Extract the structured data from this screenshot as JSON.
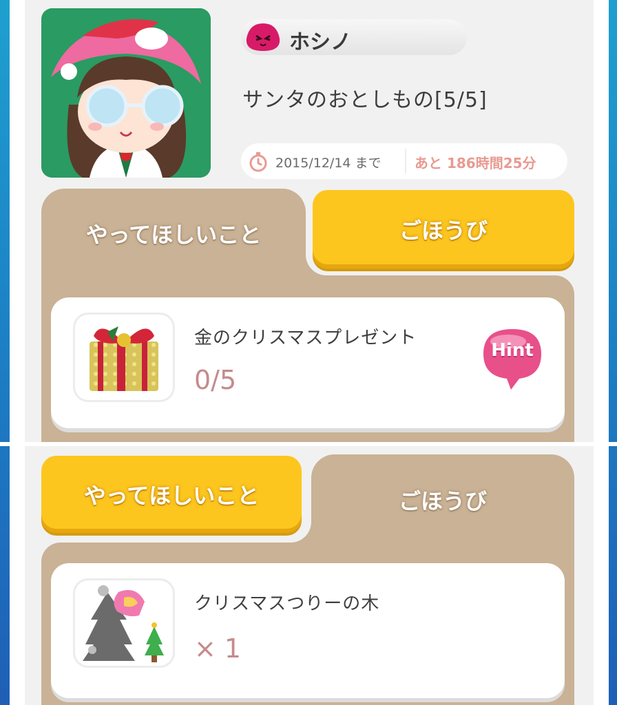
{
  "header": {
    "user_name": "ホシノ",
    "quest_title": "サンタのおとしもの[5/5]",
    "deadline": "2015/12/14 まで",
    "remaining": "あと 186時間25分"
  },
  "tabs": {
    "requests_label": "やってほしいこと",
    "rewards_label": "ごほうび"
  },
  "request_item": {
    "name": "金のクリスマスプレゼント",
    "progress": "0/5",
    "progress_current": 0,
    "progress_total": 5,
    "hint_label": "Hint",
    "icon": "gold-gift-icon"
  },
  "reward_item": {
    "name": "クリスマスつりーの木",
    "quantity": "× 1",
    "icon": "christmas-tree-icon"
  },
  "colors": {
    "tab_active": "#fcc61e",
    "tab_inactive": "#c9b295",
    "count_text": "#c48b8c",
    "remaining_text": "#e89a91",
    "hint_pink": "#e8508a",
    "side_bar_blue": "#1c7fc4"
  }
}
